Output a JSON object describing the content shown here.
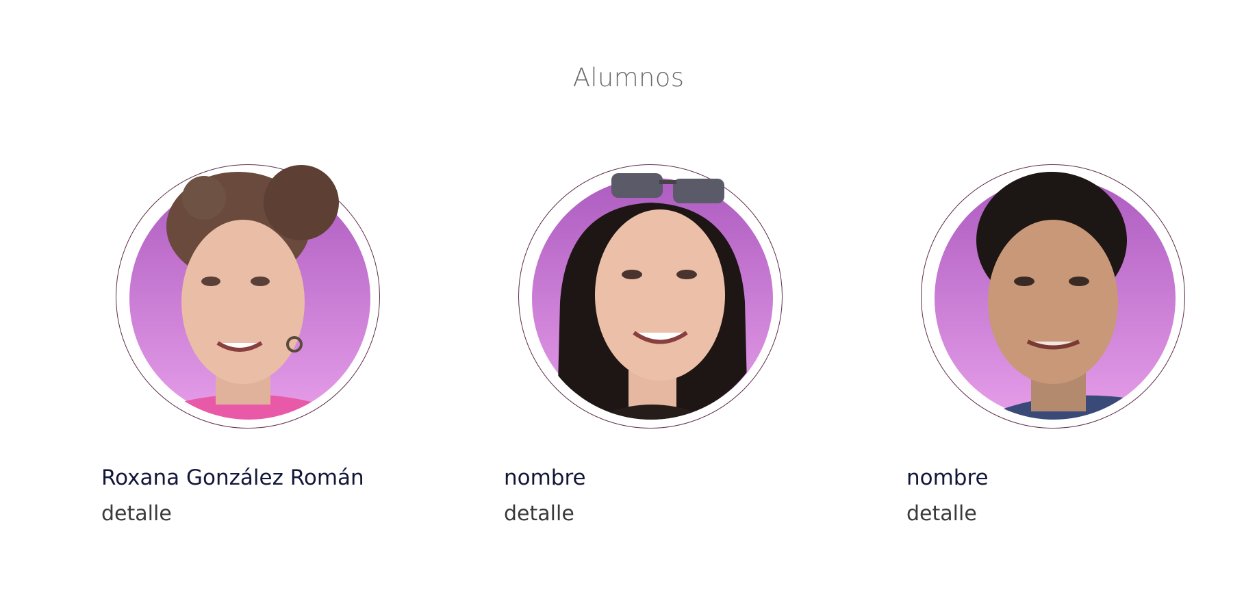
{
  "section": {
    "title": "Alumnos"
  },
  "students": [
    {
      "name": "Roxana González Román",
      "detail": "detalle",
      "avatar_icon": "student-photo-icon"
    },
    {
      "name": "nombre",
      "detail": "detalle",
      "avatar_icon": "student-photo-icon"
    },
    {
      "name": "nombre",
      "detail": "detalle",
      "avatar_icon": "student-photo-icon"
    }
  ],
  "colors": {
    "title": "#6b6b6b",
    "name": "#121739",
    "detail": "#3a3a3a",
    "ring": "#5e2c4a",
    "avatar_bg_top": "#b060c0",
    "avatar_bg_bottom": "#e29ae7"
  }
}
